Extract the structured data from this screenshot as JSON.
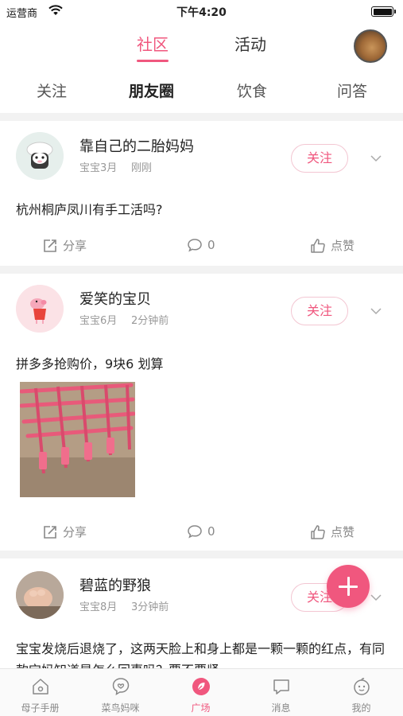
{
  "status_bar": {
    "carrier": "运营商",
    "time": "下午4:20"
  },
  "header": {
    "tabs": [
      {
        "label": "社区",
        "active": true
      },
      {
        "label": "活动",
        "active": false
      }
    ]
  },
  "subtabs": [
    {
      "label": "关注",
      "active": false
    },
    {
      "label": "朋友圈",
      "active": true
    },
    {
      "label": "饮食",
      "active": false
    },
    {
      "label": "问答",
      "active": false
    }
  ],
  "posts": [
    {
      "author": "靠自己的二胎妈妈",
      "baby_age": "宝宝3月",
      "time": "刚刚",
      "follow_label": "关注",
      "content": "杭州桐庐凤川有手工活吗?",
      "share_label": "分享",
      "comment_count": "0",
      "like_label": "点赞"
    },
    {
      "author": "爱笑的宝贝",
      "baby_age": "宝宝6月",
      "time": "2分钟前",
      "follow_label": "关注",
      "content": "拼多多抢购价，9块6  划算",
      "share_label": "分享",
      "comment_count": "0",
      "like_label": "点赞"
    },
    {
      "author": "碧蓝的野狼",
      "baby_age": "宝宝8月",
      "time": "3分钟前",
      "follow_label": "关注",
      "content": "宝宝发烧后退烧了，这两天脸上和身上都是一颗一颗的红点，有同款宝妈知道是怎么回事吗？要不要紧"
    }
  ],
  "bottom_nav": [
    {
      "label": "母子手册",
      "icon": "home-icon",
      "active": false
    },
    {
      "label": "菜鸟妈咪",
      "icon": "chat-bubble-icon",
      "active": false
    },
    {
      "label": "广场",
      "icon": "leaf-icon",
      "active": true
    },
    {
      "label": "消息",
      "icon": "message-icon",
      "active": false
    },
    {
      "label": "我的",
      "icon": "profile-face-icon",
      "active": false
    }
  ],
  "colors": {
    "accent": "#f0577e",
    "follow_border": "#f3c6d2",
    "divider": "#f2f2f2",
    "muted": "#999999"
  }
}
